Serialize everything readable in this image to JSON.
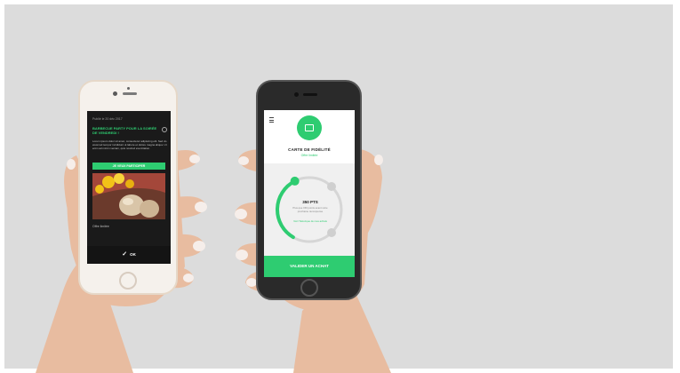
{
  "left_phone": {
    "top_line": "Publié le 20 déc 2017",
    "headline": "BARBECUE PARTY POUR LA SOIRÉE DE VENDREDI !",
    "body": "Lorem ipsum dolor sit amet, consectetur adipiscing elit. Sed do eiusmod tempor incididunt ut labore et dolore magna aliqua. Ut enim ad minim veniam, quis nostrud exercitation.",
    "button_label": "JE VEUX PARTICIPER",
    "photo_caption": "Offre limitée",
    "ok_label": "OK",
    "check_icon": "✓"
  },
  "right_phone": {
    "card_title": "CARTE DE FIDÉLITÉ",
    "card_subtitle": "Offre limitée",
    "points": "350 PTS",
    "points_desc": "Plus que 150 points avant votre prochaine récompense",
    "points_link": "Voir l'historique de mes achats",
    "validate_label": "VALIDER UN ACHAT",
    "progress_fraction": 0.62,
    "accent_color": "#2ecc71"
  }
}
